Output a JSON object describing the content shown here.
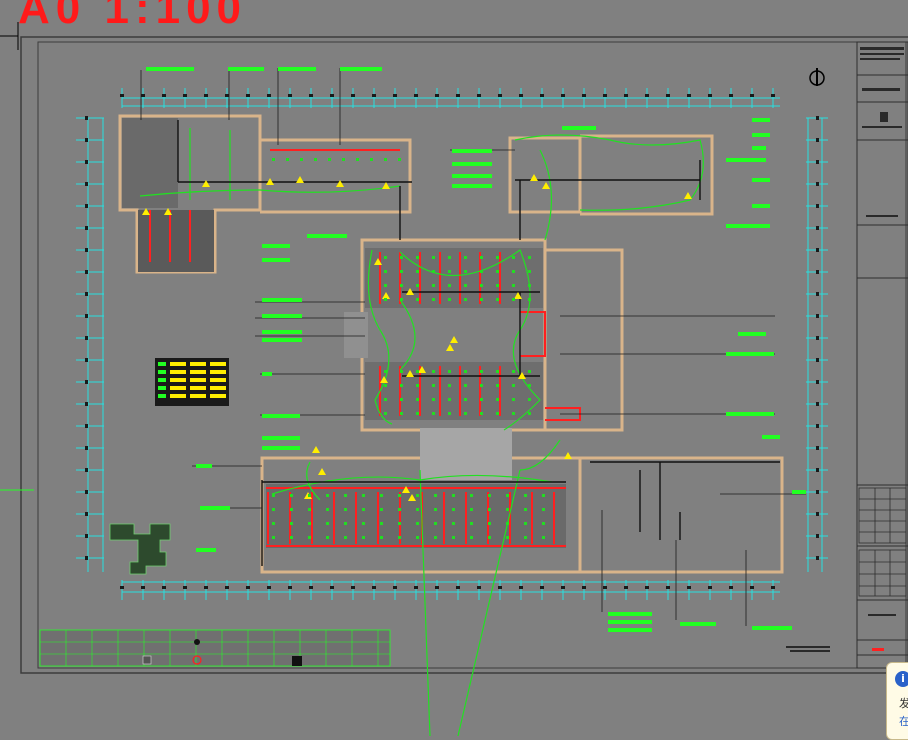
{
  "drawing": {
    "scale_text": "A0   1:100",
    "north_symbol": "N",
    "legend_table_rows": 5,
    "schedule_rows": 7
  },
  "notification": {
    "info_glyph": "i",
    "line1": "发",
    "line2": "在"
  },
  "colors": {
    "background": "#808080",
    "frame": "#4a4a4a",
    "cyan": "#28e0e0",
    "green": "#1fdc1f",
    "bright_green": "#22ff22",
    "red": "#ff2020",
    "yellow": "#ffee00",
    "tan": "#d9b48a",
    "black": "#000000"
  }
}
